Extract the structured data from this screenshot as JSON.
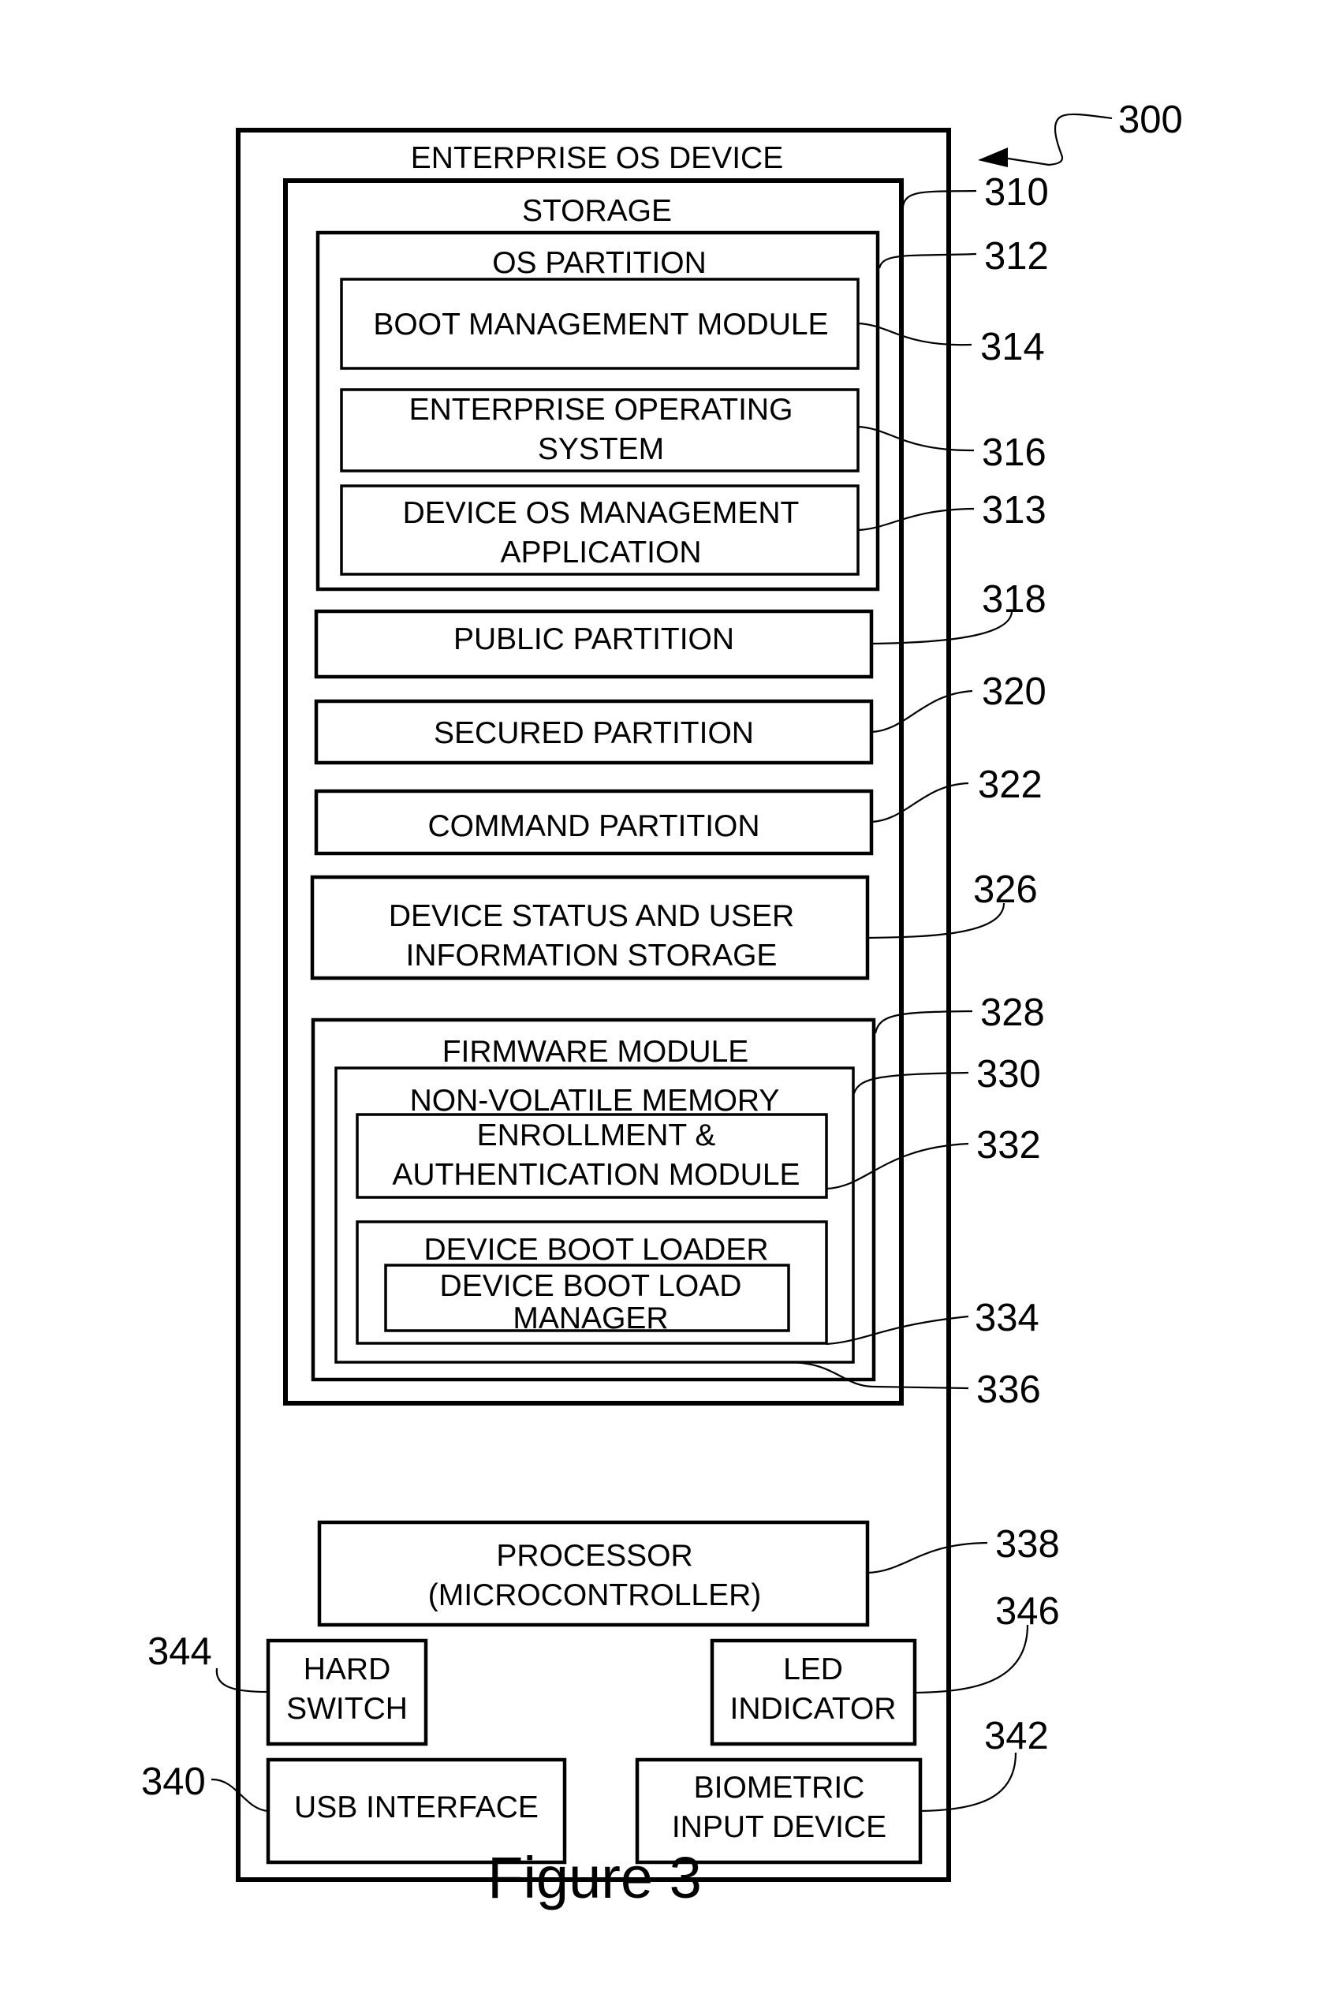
{
  "figure": {
    "caption": "Figure 3",
    "reference": "300"
  },
  "device": {
    "title": "ENTERPRISE OS DEVICE",
    "storage": {
      "title": "STORAGE",
      "ref": "310",
      "os_partition": {
        "title": "OS PARTITION",
        "ref": "312",
        "boot_management_module": {
          "lines": [
            "BOOT MANAGEMENT MODULE"
          ],
          "ref": "314"
        },
        "enterprise_operating_system": {
          "lines": [
            "ENTERPRISE OPERATING",
            "SYSTEM"
          ],
          "ref": "316"
        },
        "device_os_management_application": {
          "lines": [
            "DEVICE OS MANAGEMENT",
            "APPLICATION"
          ],
          "ref": "313"
        }
      },
      "public_partition": {
        "lines": [
          "PUBLIC PARTITION"
        ],
        "ref": "318"
      },
      "secured_partition": {
        "lines": [
          "SECURED PARTITION"
        ],
        "ref": "320"
      },
      "command_partition": {
        "lines": [
          "COMMAND PARTITION"
        ],
        "ref": "322"
      },
      "device_status_storage": {
        "lines": [
          "DEVICE STATUS AND USER",
          "INFORMATION STORAGE"
        ],
        "ref": "326"
      },
      "firmware_module": {
        "title": "FIRMWARE MODULE",
        "ref": "328",
        "non_volatile_memory": {
          "title": "NON-VOLATILE MEMORY",
          "ref": "330",
          "enrollment_authentication_module": {
            "lines": [
              "ENROLLMENT &",
              "AUTHENTICATION MODULE"
            ],
            "ref": "332"
          },
          "device_boot_loader": {
            "title": "DEVICE BOOT LOADER",
            "ref": "334",
            "device_boot_load_manager": {
              "lines": [
                "DEVICE BOOT LOAD",
                "MANAGER"
              ],
              "ref": "336"
            }
          }
        }
      }
    },
    "processor": {
      "lines": [
        "PROCESSOR",
        "(MICROCONTROLLER)"
      ],
      "ref": "338"
    },
    "hard_switch": {
      "lines": [
        "HARD",
        "SWITCH"
      ],
      "ref": "344"
    },
    "led_indicator": {
      "lines": [
        "LED",
        "INDICATOR"
      ],
      "ref": "346"
    },
    "usb_interface": {
      "lines": [
        "USB INTERFACE"
      ],
      "ref": "340"
    },
    "biometric_input_device": {
      "lines": [
        "BIOMETRIC",
        "INPUT DEVICE"
      ],
      "ref": "342"
    }
  }
}
